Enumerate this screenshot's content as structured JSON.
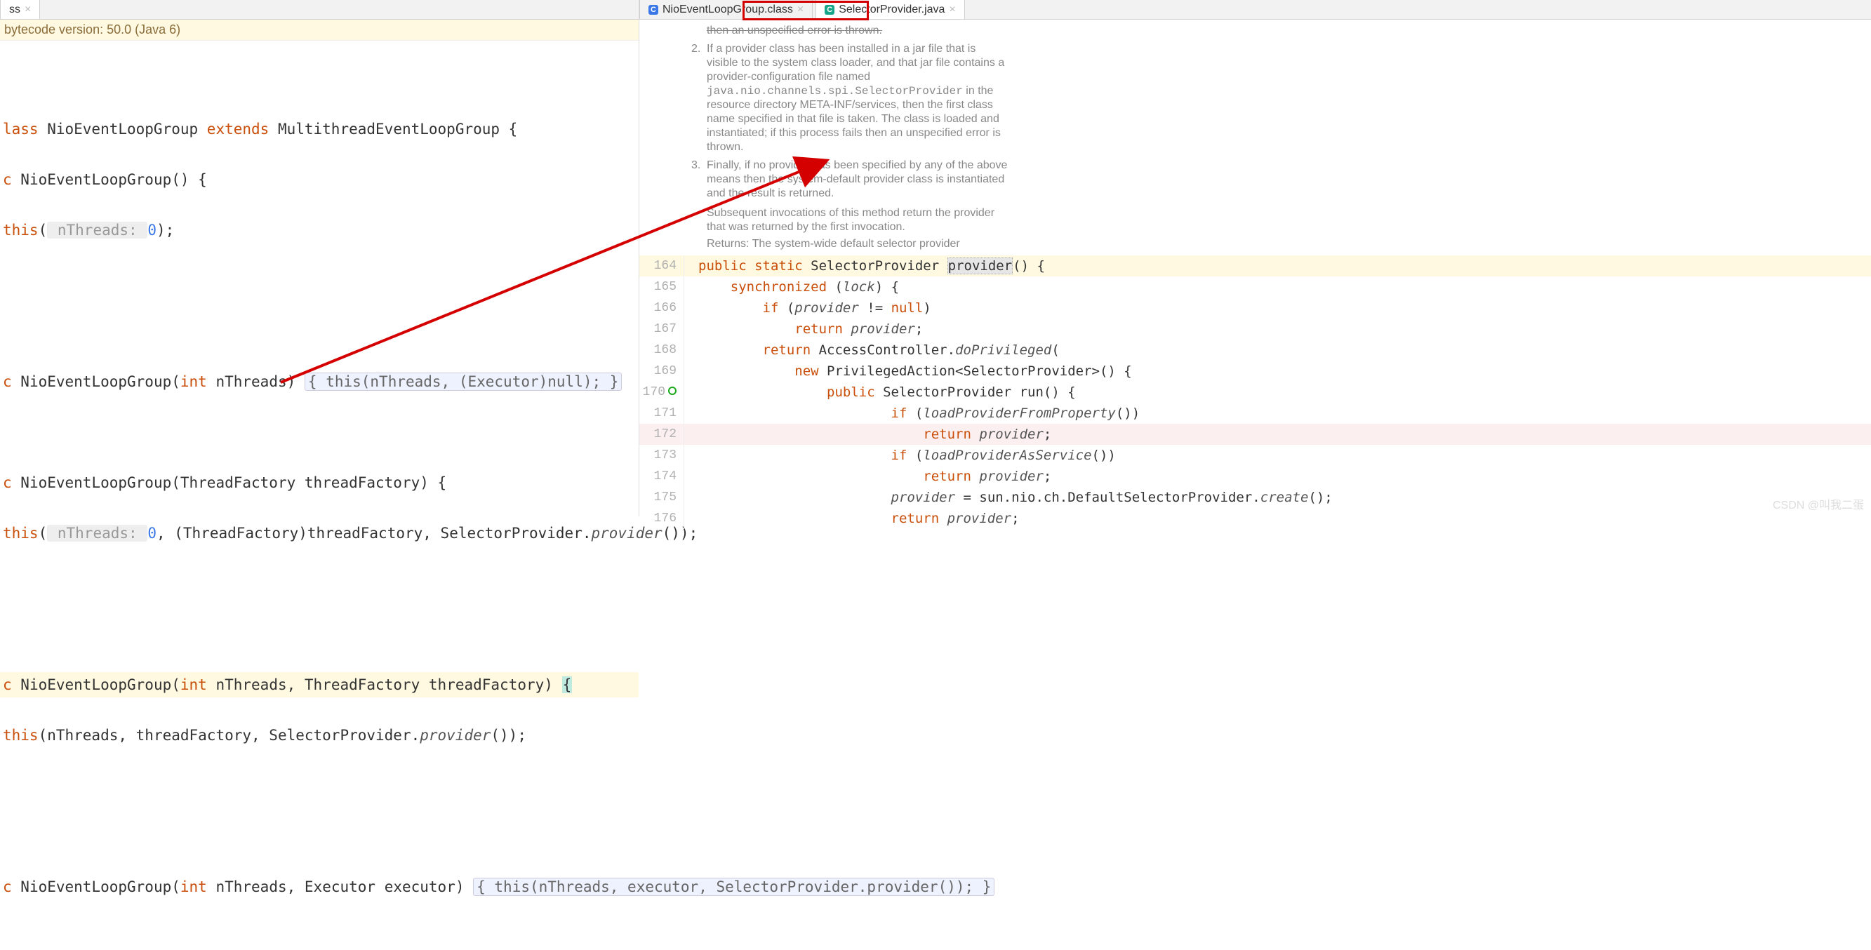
{
  "left": {
    "tab": {
      "label": "ss",
      "close_glyph": "×"
    },
    "banner": "bytecode version: 50.0 (Java 6)",
    "code": {
      "l1_a": "lass ",
      "l1_b": "NioEventLoopGroup ",
      "l1_c": "extends ",
      "l1_d": "MultithreadEventLoopGroup {",
      "l2_a": "c ",
      "l2_b": "NioEventLoopGroup",
      "l2_c": "() {",
      "l3_a": "this",
      "l3_hint": " nThreads: ",
      "l3_lit": "0",
      "l3_end": ");",
      "l5_a": "c ",
      "l5_b": "NioEventLoopGroup",
      "l5_c": "(",
      "l5_ty": "int",
      "l5_d": " nThreads) ",
      "l5_fold": "{ this(nThreads, (Executor)null); }",
      "l7_a": "c ",
      "l7_b": "NioEventLoopGroup",
      "l7_c": "(ThreadFactory threadFactory) {",
      "l8_a": "this",
      "l8_b": "(",
      "l8_hint": " nThreads: ",
      "l8_lit": "0",
      "l8_c": ", (ThreadFactory)threadFactory, SelectorProvider.",
      "l8_it": "provider",
      "l8_d": "());",
      "l10_a": "c ",
      "l10_b": "NioEventLoopGroup",
      "l10_c": "(",
      "l10_ty": "int",
      "l10_d": " nThreads, ThreadFactory threadFactory) ",
      "l10_caret": "{",
      "l11_a": "this",
      "l11_b": "(nThreads, threadFactory, SelectorProvider.",
      "l11_it": "provider",
      "l11_c": "());",
      "l13_a": "c ",
      "l13_b": "NioEventLoopGroup",
      "l13_c": "(",
      "l13_ty": "int",
      "l13_d": " nThreads, Executor executor) ",
      "l13_fold": "{ this(nThreads, executor, SelectorProvider.provider()); }"
    }
  },
  "right": {
    "tabs": {
      "t1": {
        "icon": "C",
        "label": "NioEventLoopGroup.class",
        "close": "×"
      },
      "t2": {
        "icon": "C",
        "label": "SelectorProvider.java",
        "close": "×"
      }
    },
    "doc": {
      "li1_tail": "then an unspecified error is thrown.",
      "li2_a": "If a provider class has been installed in a jar file that is visible to the system class loader, and that jar file contains a provider-configuration file named ",
      "li2_code": "java.nio.channels.spi.SelectorProvider",
      "li2_b": " in the resource directory META-INF/services, then the first class name specified in that file is taken. The class is loaded and instantiated; if this process fails then an unspecified error is thrown.",
      "li3": "Finally, if no provider has been specified by any of the above means then the system-default provider class is instantiated and the result is returned.",
      "subseq": "Subsequent invocations of this method return the provider that was returned by the first invocation.",
      "returns_lbl": "Returns:",
      "returns_txt": " The system-wide default selector provider"
    },
    "lines": {
      "n164": "164",
      "c164_a": "public static ",
      "c164_b": "SelectorProvider ",
      "c164_c": "provider",
      "c164_d": "() {",
      "n165": "165",
      "c165_a": "    synchronized ",
      "c165_b": "(",
      "c165_c": "lock",
      "c165_d": ") {",
      "n166": "166",
      "c166_a": "        if ",
      "c166_b": "(",
      "c166_c": "provider",
      "c166_d": " != ",
      "c166_e": "null",
      "c166_f": ")",
      "n167": "167",
      "c167_a": "            return ",
      "c167_b": "provider",
      "c167_c": ";",
      "n168": "168",
      "c168_a": "        return ",
      "c168_b": "AccessController.",
      "c168_c": "doPrivileged",
      "c168_d": "(",
      "n169": "169",
      "c169_a": "            new ",
      "c169_b": "PrivilegedAction<SelectorProvider>() {",
      "n170": "170",
      "c170_a": "                public ",
      "c170_b": "SelectorProvider ",
      "c170_c": "run",
      "c170_d": "() {",
      "n171": "171",
      "c171_a": "                        if ",
      "c171_b": "(",
      "c171_c": "loadProviderFromProperty",
      "c171_d": "())",
      "n172": "172",
      "c172_a": "                            return ",
      "c172_b": "provider",
      "c172_c": ";",
      "n173": "173",
      "c173_a": "                        if ",
      "c173_b": "(",
      "c173_c": "loadProviderAsService",
      "c173_d": "())",
      "n174": "174",
      "c174_a": "                            return ",
      "c174_b": "provider",
      "c174_c": ";",
      "n175": "175",
      "c175_a": "                        ",
      "c175_b": "provider",
      "c175_c": " = sun.nio.ch.DefaultSelectorProvider.",
      "c175_d": "create",
      "c175_e": "();",
      "n176": "176",
      "c176_a": "                        return ",
      "c176_b": "provider",
      "c176_c": ";"
    }
  },
  "watermark": "CSDN @叫我二蛋"
}
